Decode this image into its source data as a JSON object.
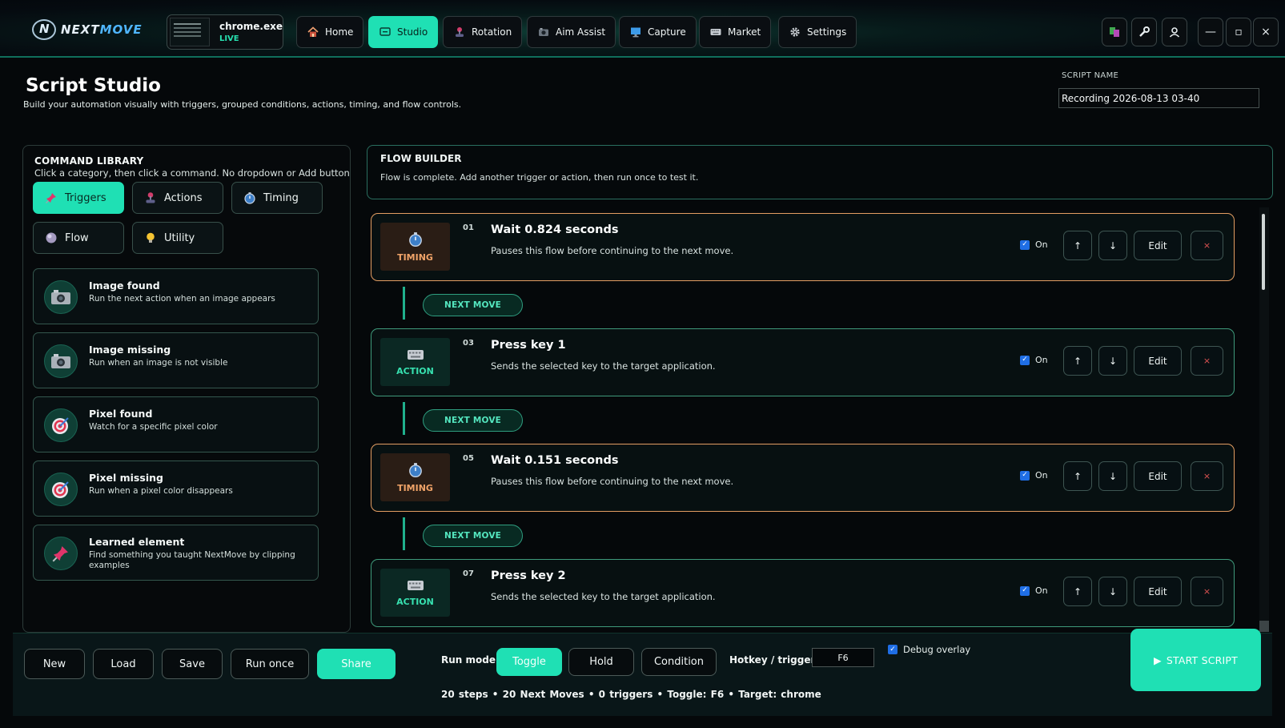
{
  "brand": {
    "name_part1": "NEXT",
    "name_part2": "MOVE",
    "logo_icon": "nextmove-logo-icon"
  },
  "target_app": {
    "name": "chrome.exe",
    "status": "LIVE"
  },
  "nav": {
    "items": [
      {
        "label": "Home",
        "icon": "house-icon",
        "active": false
      },
      {
        "label": "Studio",
        "icon": "monitor-icon",
        "active": true
      },
      {
        "label": "Rotation",
        "icon": "joystick-icon",
        "active": false
      },
      {
        "label": "Aim Assist",
        "icon": "camera-icon",
        "active": false
      },
      {
        "label": "Capture",
        "icon": "screen-icon",
        "active": false
      },
      {
        "label": "Market",
        "icon": "keyboard-icon",
        "active": false
      },
      {
        "label": "Settings",
        "icon": "gear-icon",
        "active": false
      }
    ],
    "window_buttons": {
      "minimize": "—",
      "maximize": "▫",
      "close": "×"
    }
  },
  "header": {
    "title": "Script Studio",
    "subtitle": "Build your automation visually with triggers, grouped conditions, actions, timing, and flow controls.",
    "script_name_label": "SCRIPT NAME",
    "script_name_value": "Recording 2026-08-13 03-40"
  },
  "library": {
    "title": "COMMAND LIBRARY",
    "hint": "Click a category, then click a command. No dropdown or Add button required.",
    "categories": [
      {
        "label": "Triggers",
        "icon": "pin-icon",
        "active": true
      },
      {
        "label": "Actions",
        "icon": "joystick-icon",
        "active": false
      },
      {
        "label": "Timing",
        "icon": "stopwatch-icon",
        "active": false
      },
      {
        "label": "Flow",
        "icon": "orb-icon",
        "active": false
      },
      {
        "label": "Utility",
        "icon": "lightbulb-icon",
        "active": false
      }
    ],
    "commands": [
      {
        "name": "Image found",
        "desc": "Run the next action when an image appears",
        "icon": "camera-icon"
      },
      {
        "name": "Image missing",
        "desc": "Run when an image is not visible",
        "icon": "camera-icon"
      },
      {
        "name": "Pixel found",
        "desc": "Watch for a specific pixel color",
        "icon": "target-icon"
      },
      {
        "name": "Pixel missing",
        "desc": "Run when a pixel color disappears",
        "icon": "target-icon"
      },
      {
        "name": "Learned element",
        "desc": "Find something you taught NextMove by clipping examples",
        "icon": "pin-icon"
      }
    ]
  },
  "flow": {
    "title": "FLOW BUILDER",
    "message": "Flow is complete. Add another trigger or action, then run once to test it.",
    "connector_label": "NEXT MOVE",
    "on_label": "On",
    "edit_label": "Edit",
    "up_label": "↑",
    "down_label": "↓",
    "delete_label": "×",
    "steps": [
      {
        "num": "01",
        "kind": "TIMING",
        "title": "Wait 0.824 seconds",
        "desc": "Pauses this flow before continuing to the next move.",
        "icon": "stopwatch-icon"
      },
      {
        "num": "03",
        "kind": "ACTION",
        "title": "Press key 1",
        "desc": "Sends the selected key to the target application.",
        "icon": "keyboard-icon"
      },
      {
        "num": "05",
        "kind": "TIMING",
        "title": "Wait 0.151 seconds",
        "desc": "Pauses this flow before continuing to the next move.",
        "icon": "stopwatch-icon"
      },
      {
        "num": "07",
        "kind": "ACTION",
        "title": "Press key 2",
        "desc": "Sends the selected key to the target application.",
        "icon": "keyboard-icon"
      }
    ]
  },
  "bottom": {
    "buttons": {
      "new": "New",
      "load": "Load",
      "save": "Save",
      "run_once": "Run once",
      "share": "Share"
    },
    "run_mode_label": "Run mode",
    "run_modes": [
      {
        "label": "Toggle",
        "active": true
      },
      {
        "label": "Hold",
        "active": false
      },
      {
        "label": "Condition",
        "active": false
      }
    ],
    "hotkey_label": "Hotkey / trigger",
    "hotkey_value": "F6",
    "debug_label": "Debug overlay",
    "start_label": "START SCRIPT",
    "status": "20 steps  •  20 Next Moves  •  0 triggers  •  Toggle: F6  •  Target: chrome"
  },
  "colors": {
    "accent": "#1fe0b4",
    "timing": "#e39d62",
    "action": "#37e1b0",
    "danger": "#e25454"
  }
}
